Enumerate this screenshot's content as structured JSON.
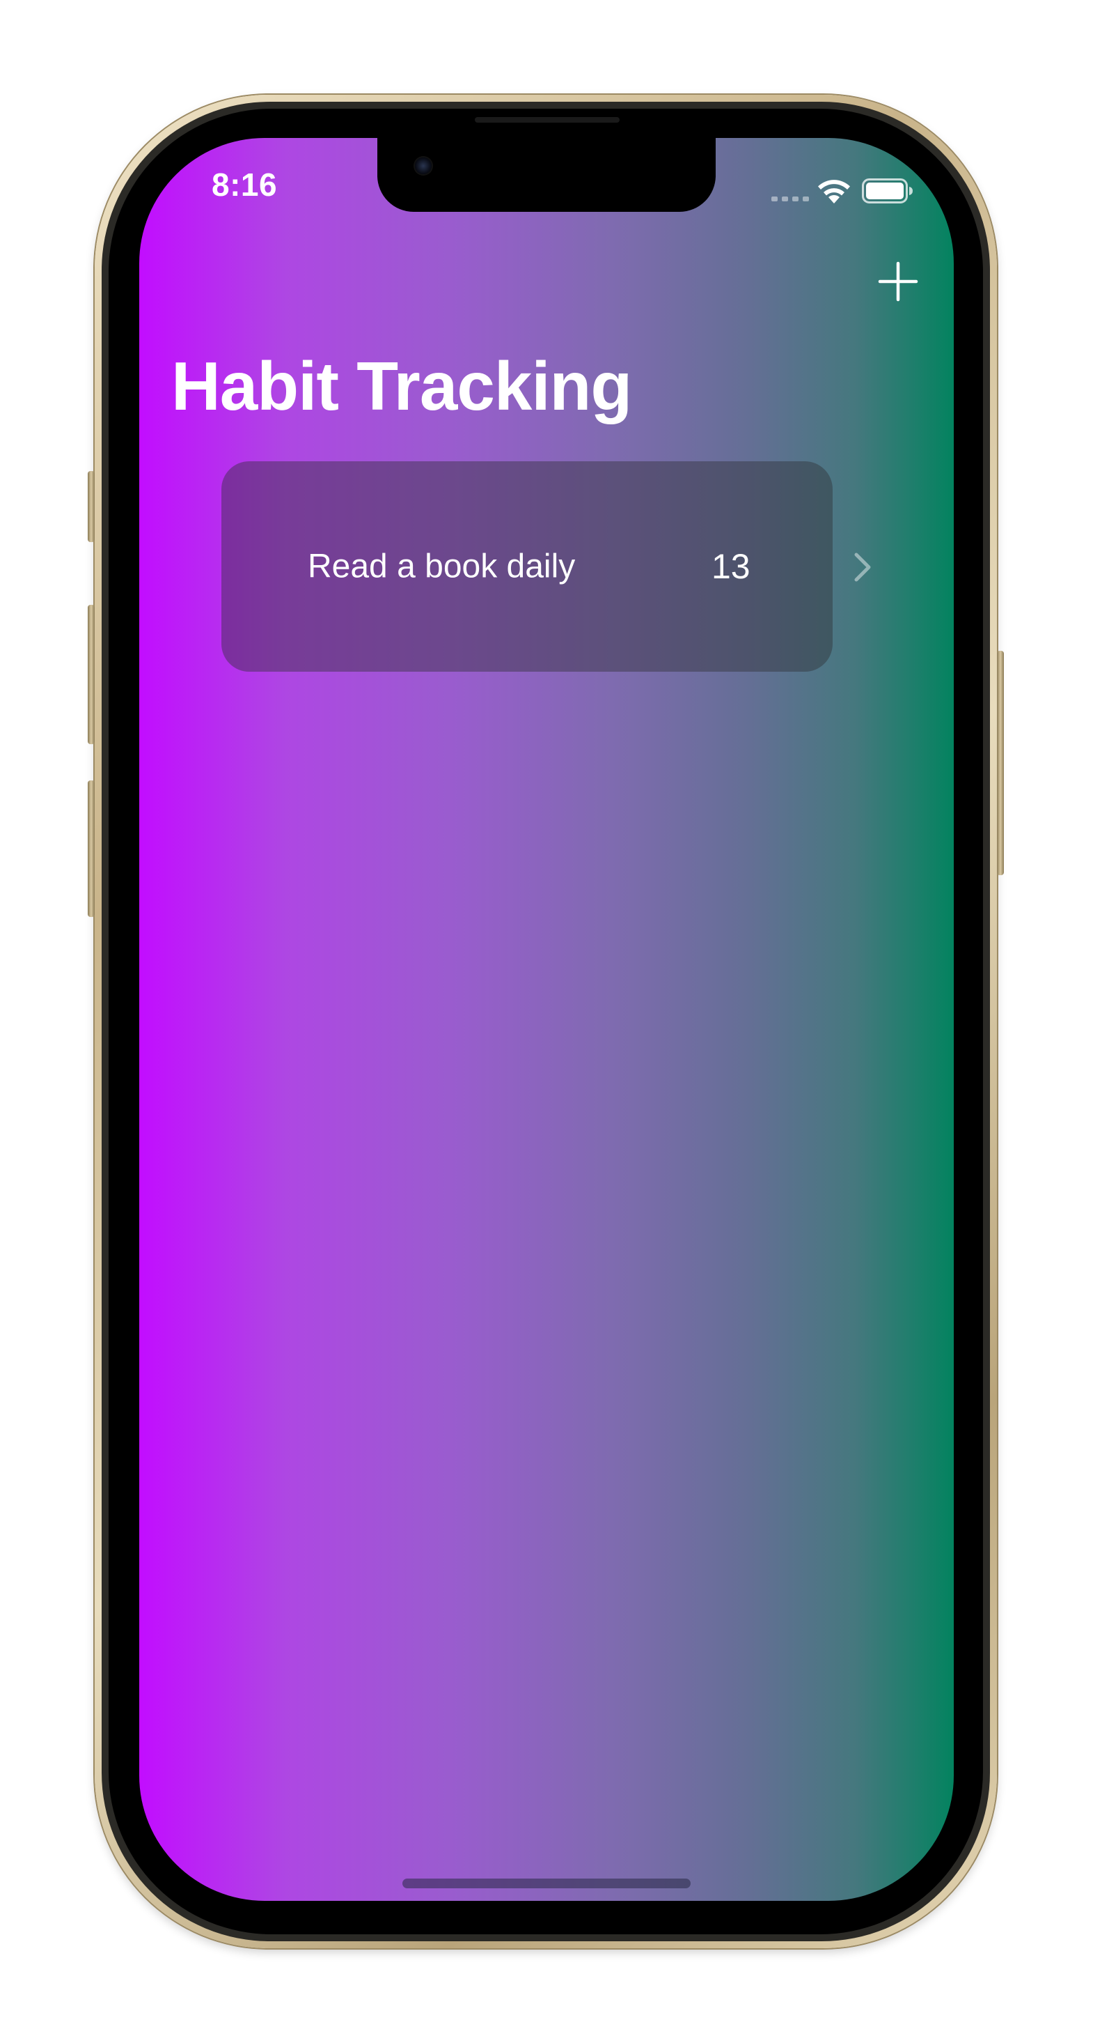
{
  "status_bar": {
    "time": "8:16",
    "icons": [
      "cellular-signal-icon",
      "wifi-icon",
      "battery-icon"
    ]
  },
  "nav": {
    "add_icon": "plus-icon"
  },
  "page": {
    "title": "Habit Tracking"
  },
  "habits": [
    {
      "name": "Read a book daily",
      "count": "13",
      "icon": "chevron-right-icon"
    }
  ],
  "colors": {
    "gradient_start": "#c20dff",
    "gradient_end": "#03835f",
    "text": "#ffffff"
  }
}
